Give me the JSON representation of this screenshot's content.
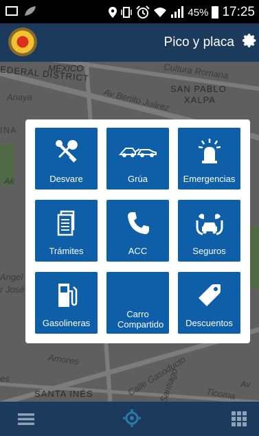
{
  "status_bar": {
    "battery": "45%",
    "time": "17:25",
    "icons": [
      "image-icon",
      "leaf-icon",
      "location-icon",
      "vibrate-icon",
      "alarm-icon",
      "wifi-icon",
      "signal-icon",
      "battery-icon"
    ]
  },
  "app_bar": {
    "title": "Pico y placa",
    "icons": [
      "logo",
      "gear-icon"
    ]
  },
  "map": {
    "labels": [
      "MEXICO",
      "EDERAL DISTRICT",
      "Cultura Romana",
      "SAN PABLO",
      "XALPA",
      "Anaya",
      "Av Benito Juárez",
      "INA",
      "Ak",
      "Angel",
      "r José",
      "Amores",
      "Calle Gasoducto",
      "SANTA INÉS",
      "Santiago",
      "Ticoma",
      "Av",
      "es"
    ]
  },
  "menu": {
    "tiles": [
      {
        "label": "Desvare",
        "icon": "wrench-screwdriver-icon"
      },
      {
        "label": "Grúa",
        "icon": "tow-truck-icon"
      },
      {
        "label": "Emergencias",
        "icon": "siren-icon"
      },
      {
        "label": "Trámites",
        "icon": "documents-icon"
      },
      {
        "label": "ACC",
        "icon": "phone-icon"
      },
      {
        "label": "Seguros",
        "icon": "insured-car-icon"
      },
      {
        "label": "Gasolineras",
        "icon": "gas-pump-icon"
      },
      {
        "label": "Carro Compartido",
        "icon": ""
      },
      {
        "label": "Descuentos",
        "icon": "tag-icon"
      }
    ]
  },
  "bottom_bar": {
    "icons": [
      "menu-icon",
      "location-target-icon",
      "grid-icon"
    ]
  },
  "colors": {
    "tile": "#0e5fa8",
    "app_bar": "#1b3a5c",
    "accent": "#2a7ab0"
  }
}
